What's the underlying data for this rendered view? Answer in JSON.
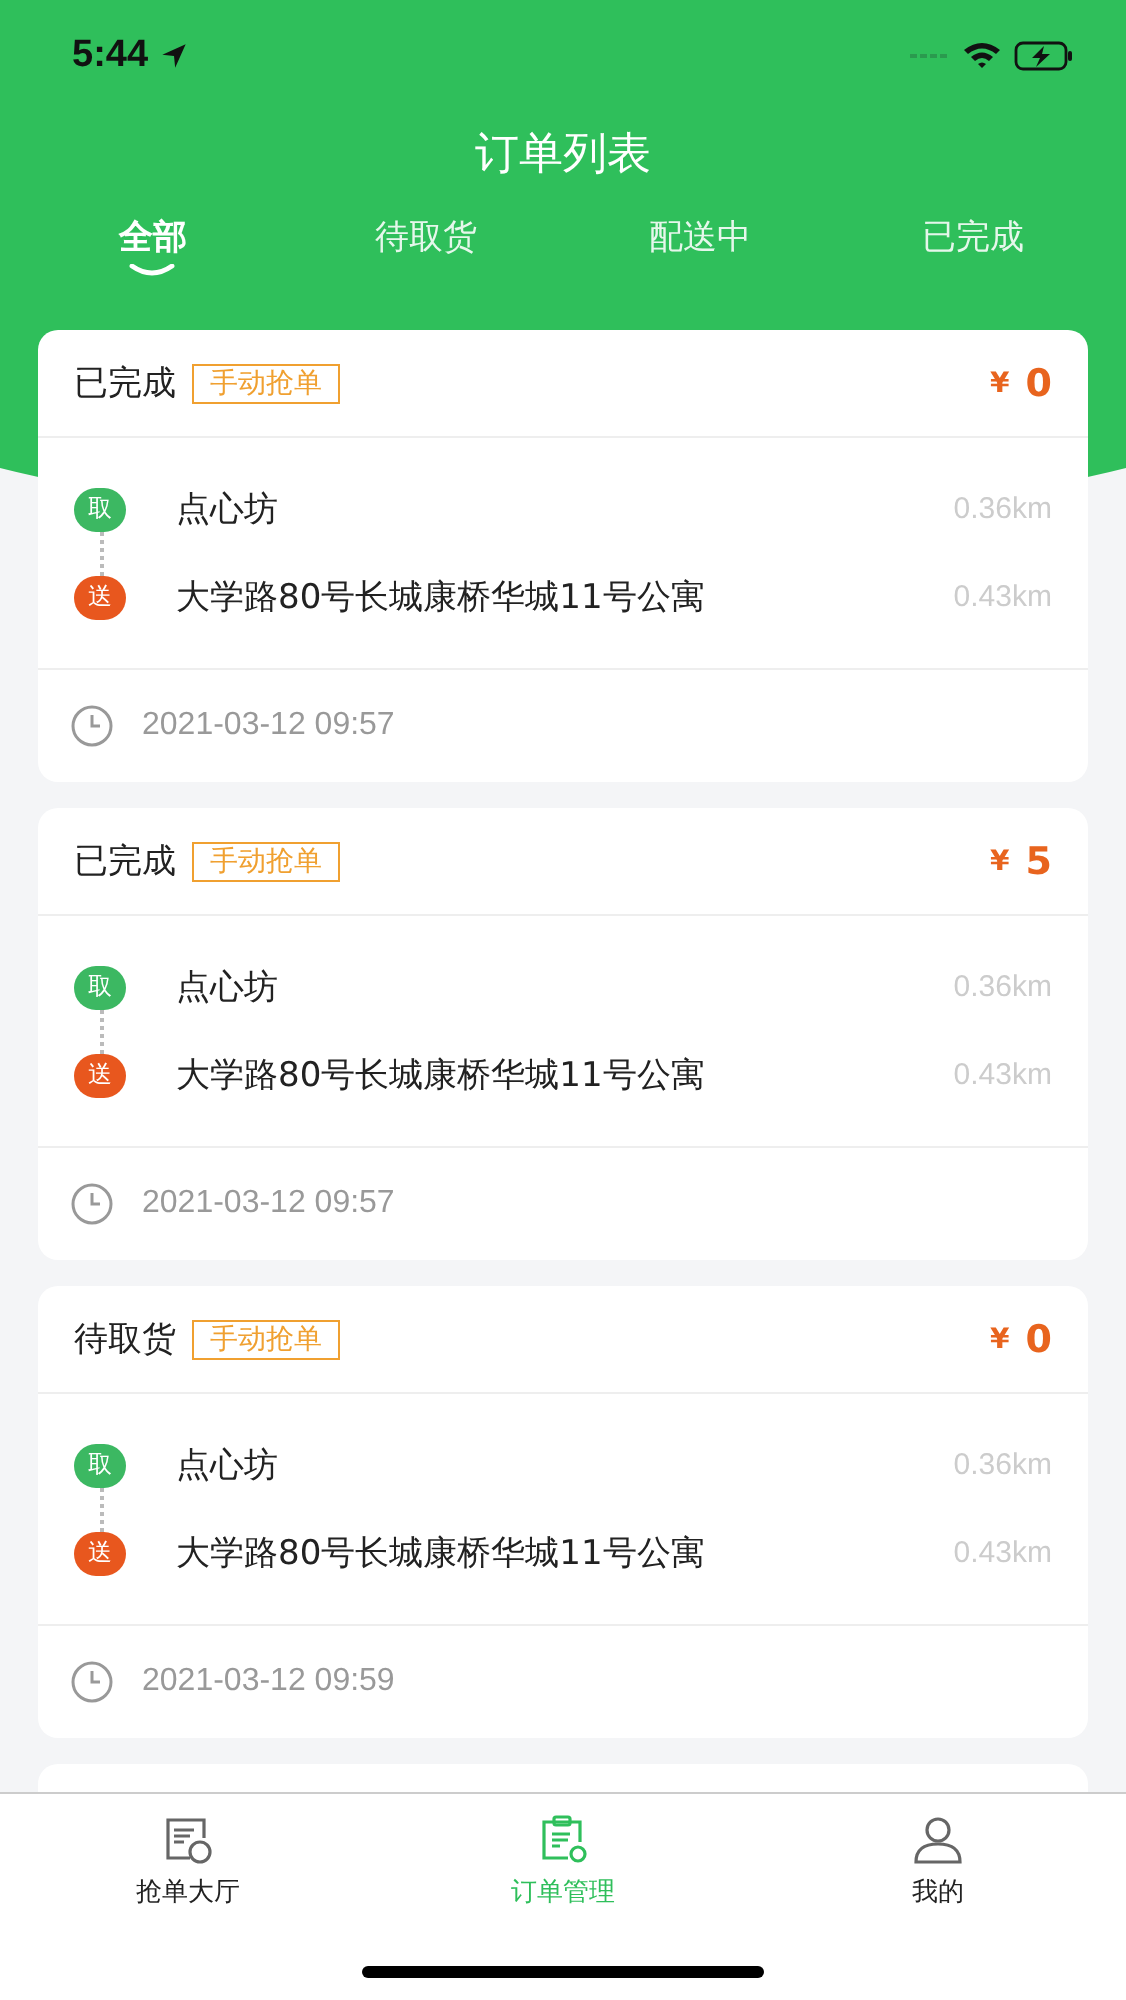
{
  "status_bar": {
    "time": "5:44"
  },
  "header": {
    "title": "订单列表"
  },
  "tabs": [
    {
      "label": "全部",
      "selected": true
    },
    {
      "label": "待取货",
      "selected": false
    },
    {
      "label": "配送中",
      "selected": false
    },
    {
      "label": "已完成",
      "selected": false
    }
  ],
  "orders": [
    {
      "status": "已完成",
      "tag": "手动抢单",
      "currency": "¥",
      "price": "0",
      "pickup_badge": "取",
      "pickup": "点心坊",
      "pickup_distance": "0.36km",
      "dropoff_badge": "送",
      "dropoff": "大学路80号长城康桥华城11号公寓",
      "dropoff_distance": "0.43km",
      "time": "2021-03-12 09:57"
    },
    {
      "status": "已完成",
      "tag": "手动抢单",
      "currency": "¥",
      "price": "5",
      "pickup_badge": "取",
      "pickup": "点心坊",
      "pickup_distance": "0.36km",
      "dropoff_badge": "送",
      "dropoff": "大学路80号长城康桥华城11号公寓",
      "dropoff_distance": "0.43km",
      "time": "2021-03-12 09:57"
    },
    {
      "status": "待取货",
      "tag": "手动抢单",
      "currency": "¥",
      "price": "0",
      "pickup_badge": "取",
      "pickup": "点心坊",
      "pickup_distance": "0.36km",
      "dropoff_badge": "送",
      "dropoff": "大学路80号长城康桥华城11号公寓",
      "dropoff_distance": "0.43km",
      "time": "2021-03-12 09:59"
    }
  ],
  "bottom_nav": [
    {
      "label": "抢单大厅",
      "kind": "hall",
      "selected": false
    },
    {
      "label": "订单管理",
      "kind": "orders",
      "selected": true
    },
    {
      "label": "我的",
      "kind": "me",
      "selected": false
    }
  ]
}
